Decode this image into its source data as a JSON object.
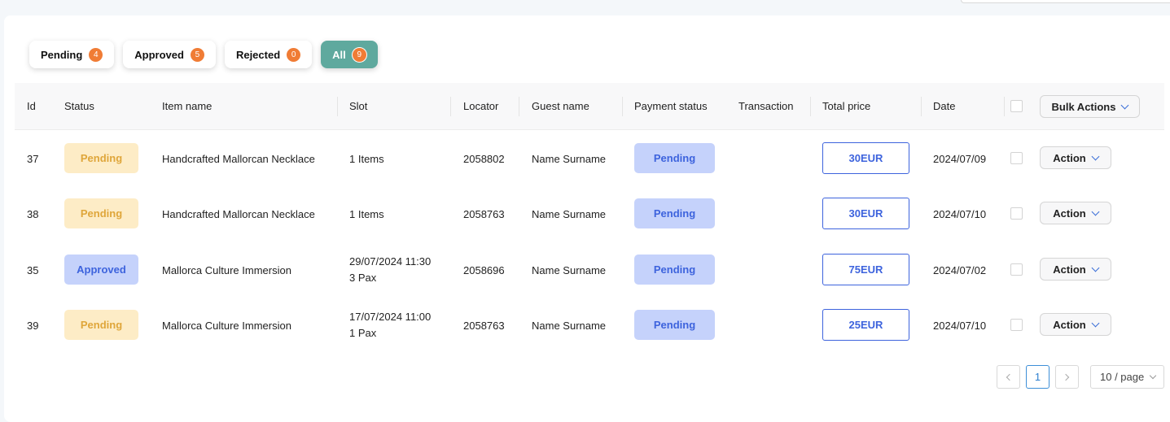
{
  "filters": [
    {
      "label": "Pending",
      "count": "4"
    },
    {
      "label": "Approved",
      "count": "5"
    },
    {
      "label": "Rejected",
      "count": "0"
    },
    {
      "label": "All",
      "count": "9"
    }
  ],
  "columns": {
    "id": "Id",
    "status": "Status",
    "item_name": "Item name",
    "slot": "Slot",
    "locator": "Locator",
    "guest_name": "Guest name",
    "payment_status": "Payment status",
    "transaction": "Transaction",
    "total_price": "Total price",
    "date": "Date"
  },
  "bulk_actions_label": "Bulk Actions",
  "rows": [
    {
      "id": "37",
      "status": "Pending",
      "item": "Handcrafted Mallorcan Necklace",
      "slot_line1": "1 Items",
      "slot_line2": "",
      "locator": "2058802",
      "guest": "Name Surname",
      "payment": "Pending",
      "transaction": "",
      "price": "30EUR",
      "date": "2024/07/09",
      "action": "Action"
    },
    {
      "id": "38",
      "status": "Pending",
      "item": "Handcrafted Mallorcan Necklace",
      "slot_line1": "1 Items",
      "slot_line2": "",
      "locator": "2058763",
      "guest": "Name Surname",
      "payment": "Pending",
      "transaction": "",
      "price": "30EUR",
      "date": "2024/07/10",
      "action": "Action"
    },
    {
      "id": "35",
      "status": "Approved",
      "item": "Mallorca Culture Immersion",
      "slot_line1": "29/07/2024 11:30",
      "slot_line2": "3 Pax",
      "locator": "2058696",
      "guest": "Name Surname",
      "payment": "Pending",
      "transaction": "",
      "price": "75EUR",
      "date": "2024/07/02",
      "action": "Action"
    },
    {
      "id": "39",
      "status": "Pending",
      "item": "Mallorca Culture Immersion",
      "slot_line1": "17/07/2024 11:00",
      "slot_line2": "1 Pax",
      "locator": "2058763",
      "guest": "Name Surname",
      "payment": "Pending",
      "transaction": "",
      "price": "25EUR",
      "date": "2024/07/10",
      "action": "Action"
    }
  ],
  "pagination": {
    "current_page": "1",
    "page_size": "10 / page"
  },
  "colors": {
    "accent": "#5fa99e",
    "badge": "#f07c35",
    "primary_blue": "#3d63dd",
    "pending_bg": "#fdecc6",
    "pending_text": "#dfa63a",
    "approved_bg": "#c5d2fb"
  }
}
